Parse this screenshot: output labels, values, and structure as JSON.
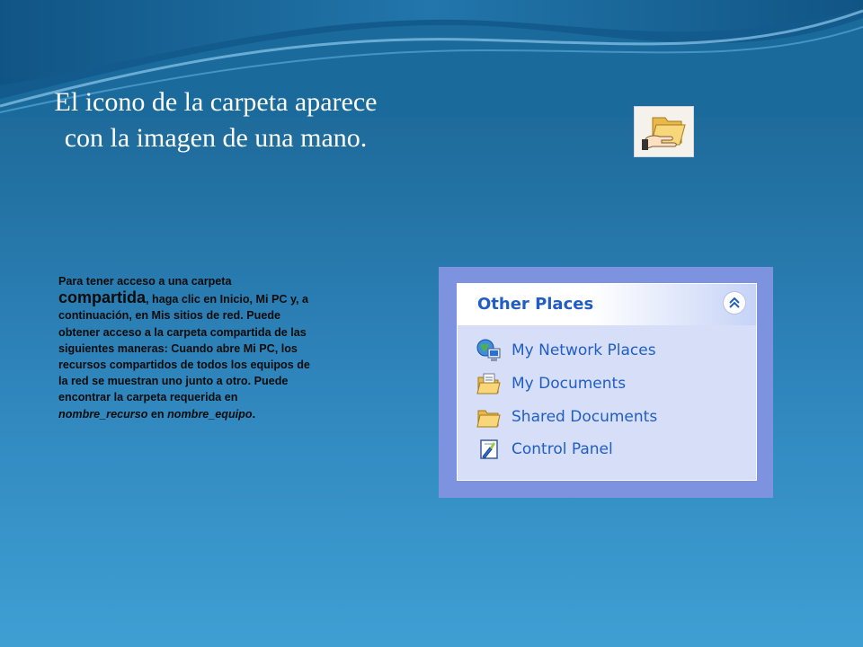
{
  "slide": {
    "title_line1": "El icono de la carpeta aparece",
    "title_line2": "con la imagen de una mano.",
    "body": {
      "part1": "Para tener acceso a una carpeta",
      "emphasis": "compartida",
      "part2": ", haga clic en Inicio, Mi PC y, a continuación, en Mis sitios de red. Puede obtener acceso a la carpeta compartida de las siguientes maneras: Cuando abre Mi PC, los recursos compartidos de todos los equipos de la red se muestran uno junto a otro. Puede encontrar la carpeta requerida en",
      "italic1": "nombre_recurso",
      "connector": "en",
      "italic2": "nombre_equipo",
      "end": "."
    }
  },
  "other_places": {
    "title": "Other Places",
    "collapse_icon": "double-chevron-up-icon",
    "items": [
      {
        "label": "My Network Places",
        "icon": "network-places-icon"
      },
      {
        "label": "My Documents",
        "icon": "documents-folder-icon"
      },
      {
        "label": "Shared Documents",
        "icon": "shared-folder-icon"
      },
      {
        "label": "Control Panel",
        "icon": "control-panel-icon"
      }
    ]
  },
  "colors": {
    "background_top": "#17628f",
    "background_bottom": "#3f9fd3",
    "link_blue": "#215dc6",
    "panel_frame": "#7d93e0",
    "panel_body": "#d6dff7"
  }
}
